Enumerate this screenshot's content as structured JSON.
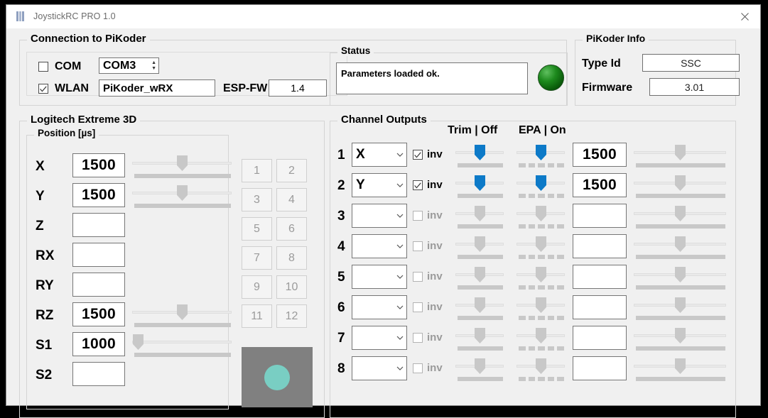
{
  "window": {
    "title": "JoystickRC PRO 1.0",
    "logo_icon": "app-bars-icon",
    "close_icon": "close-icon"
  },
  "connection": {
    "legend": "Connection to PiKoder",
    "com": {
      "label": "COM",
      "checked": false,
      "port_value": "COM3",
      "spinner_icon": "spinner-updown-icon"
    },
    "wlan": {
      "label": "WLAN",
      "checked": true,
      "ssid_value": "PiKoder_wRX"
    },
    "esp_fw": {
      "label": "ESP-FW",
      "value": "1.4"
    }
  },
  "status": {
    "legend": "Status",
    "message": "Parameters loaded ok.",
    "led_icon": "status-led-green",
    "led_color": "#1d8a1d"
  },
  "pikoder_info": {
    "legend": "PiKoder Info",
    "rows": [
      {
        "label": "Type Id",
        "value": "SSC"
      },
      {
        "label": "Firmware",
        "value": "3.01"
      }
    ]
  },
  "joystick": {
    "legend": "Logitech Extreme 3D",
    "position_legend": "Position [µs]",
    "axes": [
      {
        "label": "X",
        "value": "1500",
        "has_slider": true,
        "slider_pct": 50
      },
      {
        "label": "Y",
        "value": "1500",
        "has_slider": true,
        "slider_pct": 50
      },
      {
        "label": "Z",
        "value": "",
        "has_slider": false,
        "slider_pct": 0
      },
      {
        "label": "RX",
        "value": "",
        "has_slider": false,
        "slider_pct": 0
      },
      {
        "label": "RY",
        "value": "",
        "has_slider": false,
        "slider_pct": 0
      },
      {
        "label": "RZ",
        "value": "1500",
        "has_slider": true,
        "slider_pct": 50
      },
      {
        "label": "S1",
        "value": "1000",
        "has_slider": true,
        "slider_pct": 0
      },
      {
        "label": "S2",
        "value": "",
        "has_slider": false,
        "slider_pct": 0
      }
    ],
    "buttons": [
      "1",
      "2",
      "3",
      "4",
      "5",
      "6",
      "7",
      "8",
      "9",
      "10",
      "11",
      "12"
    ],
    "hat": {
      "name": "hat-switch",
      "dot_color": "#79cec3"
    }
  },
  "channels": {
    "legend": "Channel Outputs",
    "header_trim": "Trim | Off",
    "header_epa": "EPA | On",
    "inv_label": "inv",
    "rows": [
      {
        "num": "1",
        "source": "X",
        "inv": true,
        "enabled": true,
        "trim_pct": 50,
        "epa_pct": 50,
        "value": "1500",
        "out_pct": 50
      },
      {
        "num": "2",
        "source": "Y",
        "inv": true,
        "enabled": true,
        "trim_pct": 50,
        "epa_pct": 50,
        "value": "1500",
        "out_pct": 50
      },
      {
        "num": "3",
        "source": "",
        "inv": false,
        "enabled": false,
        "trim_pct": 50,
        "epa_pct": 50,
        "value": "",
        "out_pct": 50
      },
      {
        "num": "4",
        "source": "",
        "inv": false,
        "enabled": false,
        "trim_pct": 50,
        "epa_pct": 50,
        "value": "",
        "out_pct": 50
      },
      {
        "num": "5",
        "source": "",
        "inv": false,
        "enabled": false,
        "trim_pct": 50,
        "epa_pct": 50,
        "value": "",
        "out_pct": 50
      },
      {
        "num": "6",
        "source": "",
        "inv": false,
        "enabled": false,
        "trim_pct": 50,
        "epa_pct": 50,
        "value": "",
        "out_pct": 50
      },
      {
        "num": "7",
        "source": "",
        "inv": false,
        "enabled": false,
        "trim_pct": 50,
        "epa_pct": 50,
        "value": "",
        "out_pct": 50
      },
      {
        "num": "8",
        "source": "",
        "inv": false,
        "enabled": false,
        "trim_pct": 50,
        "epa_pct": 50,
        "value": "",
        "out_pct": 50
      }
    ],
    "active_color": "#0d7ac8",
    "inactive_color": "#c8c8c8"
  }
}
